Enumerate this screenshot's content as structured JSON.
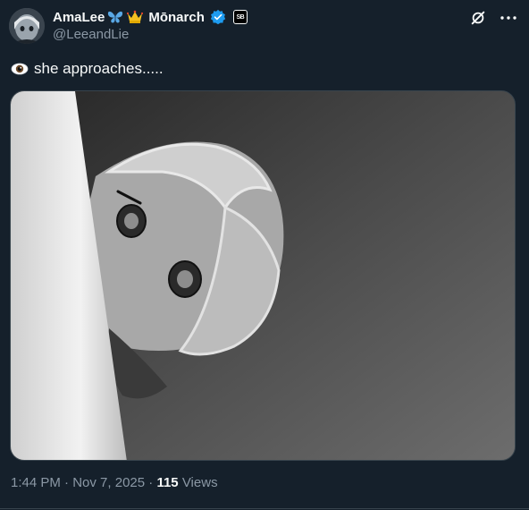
{
  "author": {
    "display_name": "AmaLee",
    "name_suffix": "Mōnarch",
    "name_emojis": [
      "butterfly-emoji",
      "crown-emoji"
    ],
    "handle": "@LeeandLie",
    "verified": true,
    "affiliate_badge": "SB",
    "avatar": "avatar-image"
  },
  "header_icons": [
    "grok-icon",
    "more-icon"
  ],
  "tweet": {
    "emoji": "eye-emoji",
    "text": "she approaches.....",
    "media": "photo-plush-doll-grayscale"
  },
  "meta": {
    "time": "1:44 PM",
    "separator": "·",
    "date": "Nov 7, 2025",
    "views_count": "115",
    "views_label": "Views"
  },
  "colors": {
    "background": "#15202b",
    "text_primary": "#f7f9f9",
    "text_secondary": "#8b98a5",
    "verified_blue": "#1d9bf0",
    "border": "#38444d"
  }
}
